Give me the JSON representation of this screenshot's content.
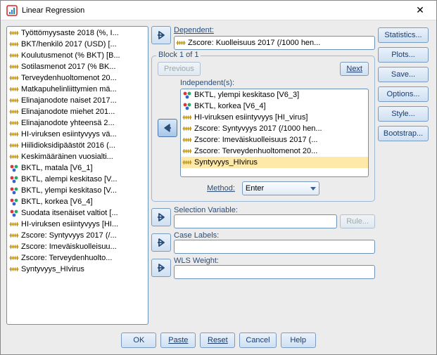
{
  "window": {
    "title": "Linear Regression",
    "close": "✕"
  },
  "source_list": [
    {
      "icon": "scale",
      "label": "Työttömyysaste 2018 (%, I..."
    },
    {
      "icon": "scale",
      "label": "BKT/henkilö 2017 (USD) [..."
    },
    {
      "icon": "scale",
      "label": "Koulutusmenot (% BKT) [B..."
    },
    {
      "icon": "scale",
      "label": "Sotilasmenot 2017 (% BK..."
    },
    {
      "icon": "scale",
      "label": "Terveydenhuoltomenot 20..."
    },
    {
      "icon": "scale",
      "label": "Matkapuhelinliittymien mä..."
    },
    {
      "icon": "scale",
      "label": "Elinajanodote naiset 2017..."
    },
    {
      "icon": "scale",
      "label": "Elinajanodote miehet 201..."
    },
    {
      "icon": "scale",
      "label": "Elinajanodote yhteensä 2..."
    },
    {
      "icon": "scale",
      "label": "HI-viruksen esiintyvyys vä..."
    },
    {
      "icon": "scale",
      "label": "Hiilidioksidipäästöt 2016 (..."
    },
    {
      "icon": "scale",
      "label": "Keskimääräinen vuosialti..."
    },
    {
      "icon": "nominal",
      "label": "BKTL, matala [V6_1]"
    },
    {
      "icon": "nominal",
      "label": "BKTL, alempi keskitaso [V..."
    },
    {
      "icon": "nominal",
      "label": "BKTL, ylempi keskitaso [V..."
    },
    {
      "icon": "nominal",
      "label": "BKTL, korkea [V6_4]"
    },
    {
      "icon": "nominal",
      "label": "Suodata itsenäiset valtiot [..."
    },
    {
      "icon": "scale",
      "label": "HI-viruksen esiintyvyys [HI..."
    },
    {
      "icon": "scale",
      "label": "Zscore:  Syntyvyys 2017 (/..."
    },
    {
      "icon": "scale",
      "label": "Zscore:  Imeväiskuolleisuu..."
    },
    {
      "icon": "scale",
      "label": "Zscore:  Terveydenhuolto..."
    },
    {
      "icon": "scale",
      "label": "Syntyvyys_HIvirus"
    }
  ],
  "dependent": {
    "label": "Dependent:",
    "value": {
      "icon": "scale",
      "label": "Zscore:  Kuolleisuus 2017 (/1000 hen..."
    }
  },
  "block": {
    "legend": "Block 1 of 1",
    "previous": "Previous",
    "next": "Next",
    "independent_label": "Independent(s):",
    "independent": [
      {
        "icon": "nominal",
        "label": "BKTL, ylempi keskitaso [V6_3]"
      },
      {
        "icon": "nominal",
        "label": "BKTL, korkea [V6_4]"
      },
      {
        "icon": "scale",
        "label": "HI-viruksen esiintyvyys [HI_virus]"
      },
      {
        "icon": "scale",
        "label": "Zscore:  Syntyvyys 2017 (/1000 hen..."
      },
      {
        "icon": "scale",
        "label": "Zscore:  Imeväiskuolleisuus 2017 (..."
      },
      {
        "icon": "scale",
        "label": "Zscore:  Terveydenhuoltomenot 20..."
      },
      {
        "icon": "scale",
        "label": "Syntyvyys_HIvirus",
        "selected": true
      }
    ],
    "method_label": "Method:",
    "method_value": "Enter"
  },
  "selection": {
    "label": "Selection Variable:",
    "rule": "Rule..."
  },
  "caselabels": {
    "label": "Case Labels:"
  },
  "wls": {
    "label": "WLS Weight:"
  },
  "sidebar": {
    "statistics": "Statistics...",
    "plots": "Plots...",
    "save": "Save...",
    "options": "Options...",
    "style": "Style...",
    "bootstrap": "Bootstrap..."
  },
  "footer": {
    "ok": "OK",
    "paste": "Paste",
    "reset": "Reset",
    "cancel": "Cancel",
    "help": "Help"
  }
}
